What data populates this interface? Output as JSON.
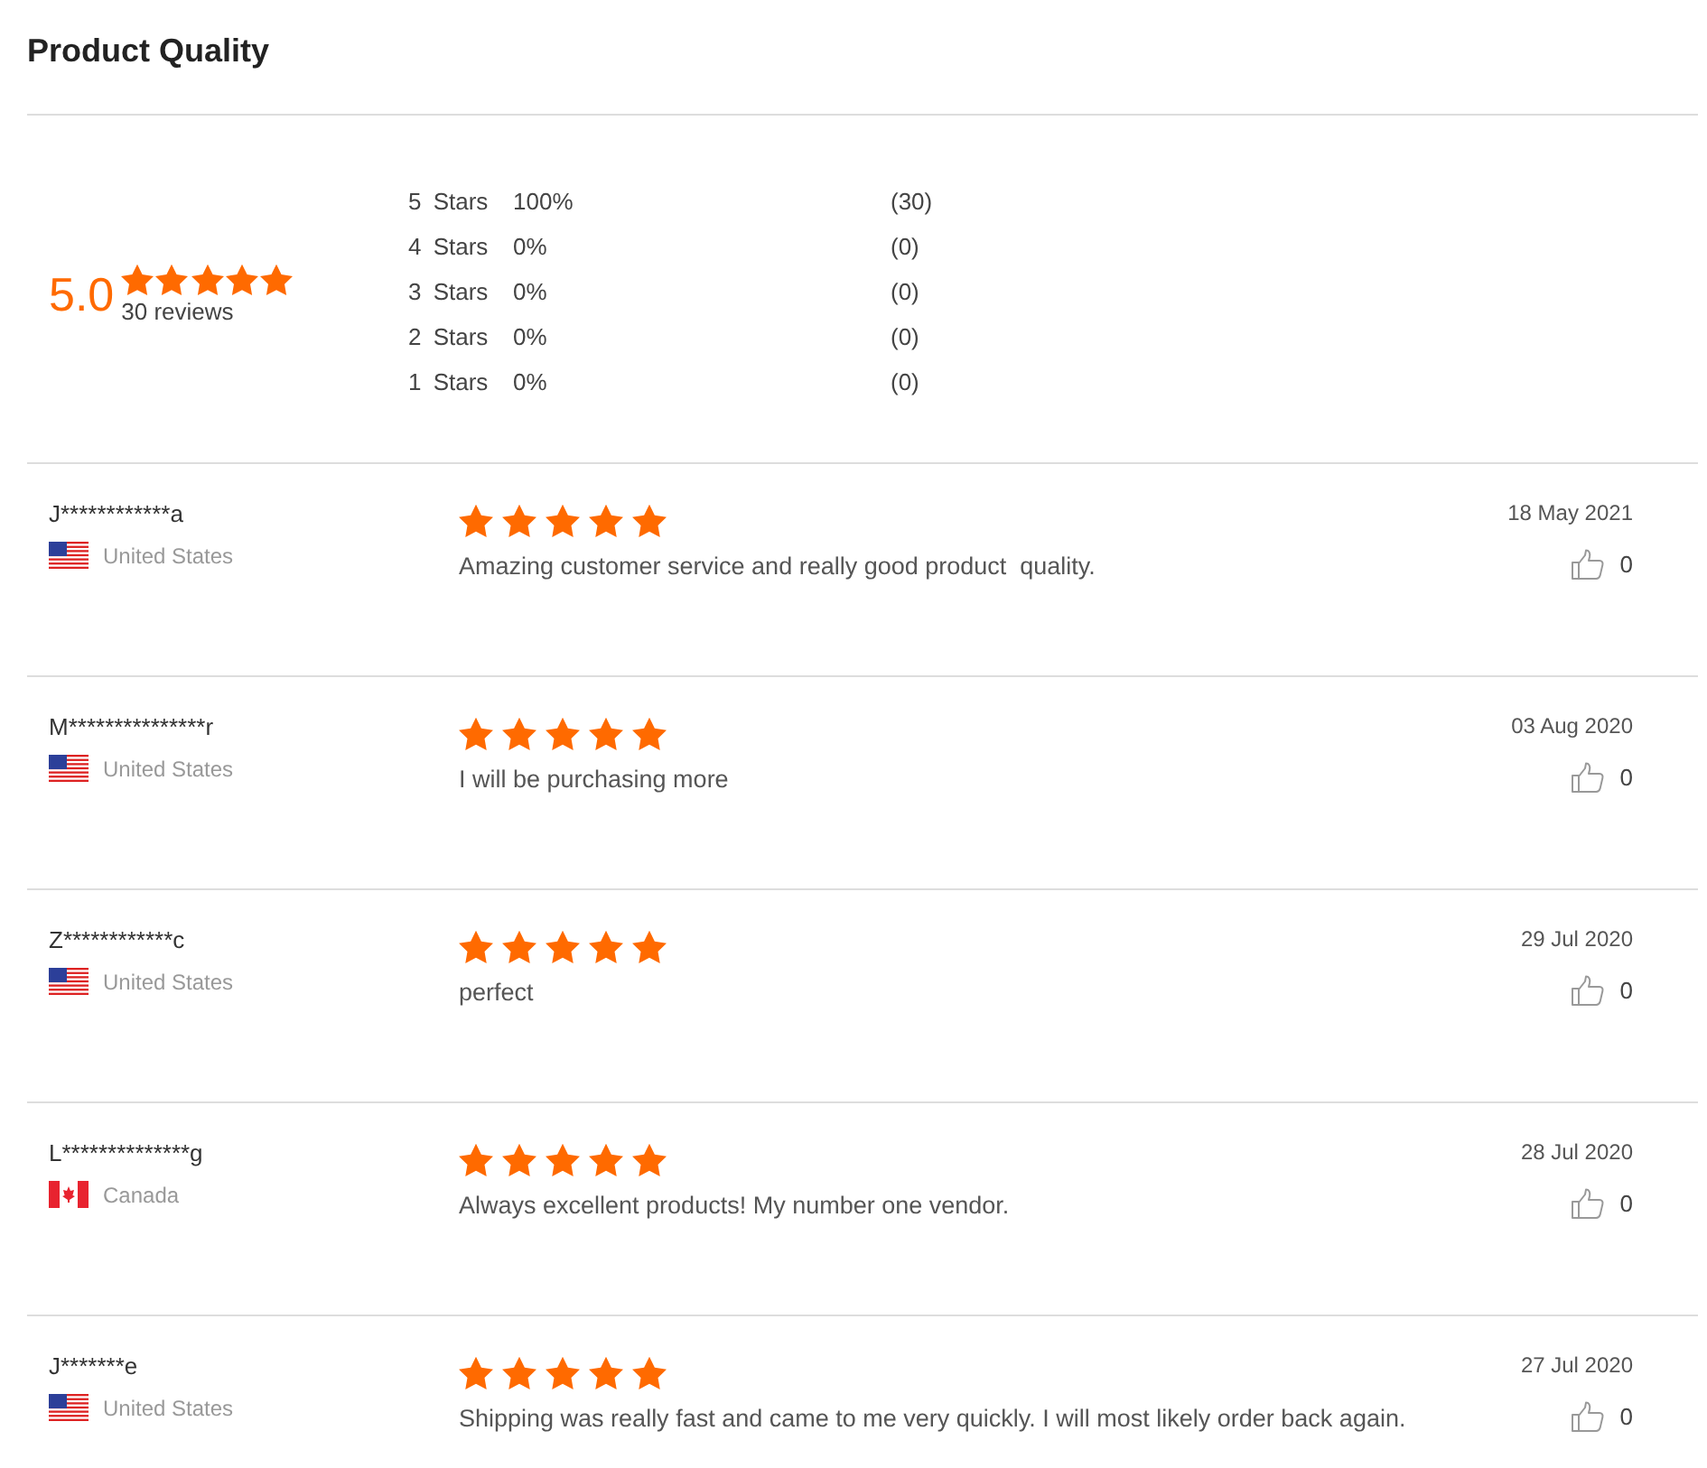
{
  "title": "Product Quality",
  "summary": {
    "score": "5.0",
    "stars": 5,
    "review_count": "30 reviews"
  },
  "distribution": [
    {
      "label": "5 Stars",
      "percent": "100%",
      "count": "(30)"
    },
    {
      "label": "4 Stars",
      "percent": "0%",
      "count": "(0)"
    },
    {
      "label": "3 Stars",
      "percent": "0%",
      "count": "(0)"
    },
    {
      "label": "2 Stars",
      "percent": "0%",
      "count": "(0)"
    },
    {
      "label": "1 Stars",
      "percent": "0%",
      "count": "(0)"
    }
  ],
  "reviews": [
    {
      "name": "J************a",
      "flag": {
        "kind": "us"
      },
      "country": "United States",
      "stars": 5,
      "comment": "Amazing customer service and really good product  quality.",
      "date": "18 May 2021",
      "likes": "0"
    },
    {
      "name": "M***************r",
      "flag": {
        "kind": "us"
      },
      "country": "United States",
      "stars": 5,
      "comment": "I will be purchasing more",
      "date": "03 Aug 2020",
      "likes": "0"
    },
    {
      "name": "Z************c",
      "flag": {
        "kind": "us"
      },
      "country": "United States",
      "stars": 5,
      "comment": "perfect",
      "date": "29 Jul 2020",
      "likes": "0"
    },
    {
      "name": "L**************g",
      "flag": {
        "kind": "ca"
      },
      "country": "Canada",
      "stars": 5,
      "comment": "Always excellent products! My number one vendor.",
      "date": "28 Jul 2020",
      "likes": "0"
    },
    {
      "name": "J*******e",
      "flag": {
        "kind": "us"
      },
      "country": "United States",
      "stars": 5,
      "comment": "Shipping was really fast and came to me very quickly. I will most likely order back again.",
      "date": "27 Jul 2020",
      "likes": "0"
    }
  ]
}
